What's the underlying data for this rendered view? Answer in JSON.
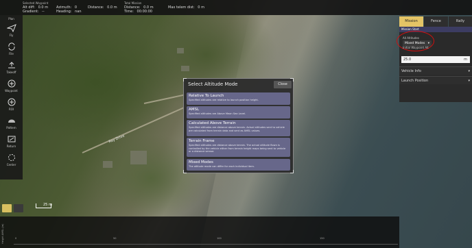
{
  "topbar": {
    "selected_waypoint": {
      "heading": "Selected Waypoint",
      "alt_diff_label": "Alt diff:",
      "alt_diff_value": "0.0 m",
      "gradient_label": "Gradient:",
      "gradient_value": "--",
      "azimuth_label": "Azimuth:",
      "azimuth_value": "0",
      "heading_label": "Heading:",
      "heading_value": "nan",
      "distance_label": "Distance:",
      "distance_value": "0.0 m"
    },
    "total_mission": {
      "heading": "Total Mission",
      "distance_label": "Distance:",
      "distance_value": "0.0 m",
      "time_label": "Time:",
      "time_value": "00:00:00",
      "max_telem_label": "Max telem dist:",
      "max_telem_value": "0 m"
    }
  },
  "leftbar": {
    "plan_label": "Plan",
    "tools": [
      {
        "label": "Fly",
        "icon": "send-icon"
      },
      {
        "label": "File",
        "icon": "sync-icon"
      },
      {
        "label": "Takeoff",
        "icon": "takeoff-icon"
      },
      {
        "label": "Waypoint",
        "icon": "plus-circle-icon"
      },
      {
        "label": "ROI",
        "icon": "plus-circle-icon"
      },
      {
        "label": "Pattern",
        "icon": "pattern-icon"
      },
      {
        "label": "Return",
        "icon": "return-icon"
      },
      {
        "label": "Center",
        "icon": "center-icon"
      }
    ]
  },
  "right_panel": {
    "tabs": [
      "Mission",
      "Fence",
      "Rally"
    ],
    "active_tab": "Mission",
    "mission_start": "Mission Start",
    "all_altitudes_label": "All Altitudes",
    "altitude_mode": "Mixed Modes",
    "initial_wp_label": "Initial Waypoint Alt",
    "initial_wp_value": "25.0",
    "initial_wp_unit": "m",
    "vehicle_info": "Vehicle Info",
    "launch_position": "Launch Position"
  },
  "dialog": {
    "title": "Select Altitude Mode",
    "close": "Close",
    "options": [
      {
        "title": "Relative To Launch",
        "desc": "Specified altitudes are relative to launch position height."
      },
      {
        "title": "AMSL",
        "desc": "Specified altitudes are Above Mean Sea Level."
      },
      {
        "title": "Calculated Above Terrain",
        "desc": "Specified altitudes are distance above terrain. Actual altitudes sent to vehicle are calculated from terrain data and sent as AMSL values."
      },
      {
        "title": "Terrain Frame",
        "desc": "Specified altitudes are distance above terrain. The actual altitude flown is controlled by the vehicle either from terrain height maps being sent to vehicle or a distance sensor."
      },
      {
        "title": "Mixed Modes",
        "desc": "The altitude mode can differ for each individual item."
      }
    ]
  },
  "map": {
    "road_label": "Ray Drive",
    "scale_label": "25 m"
  },
  "profile": {
    "axis_label": "Height AMSL (m)",
    "ticks": [
      "0",
      "50",
      "100",
      "150"
    ]
  }
}
